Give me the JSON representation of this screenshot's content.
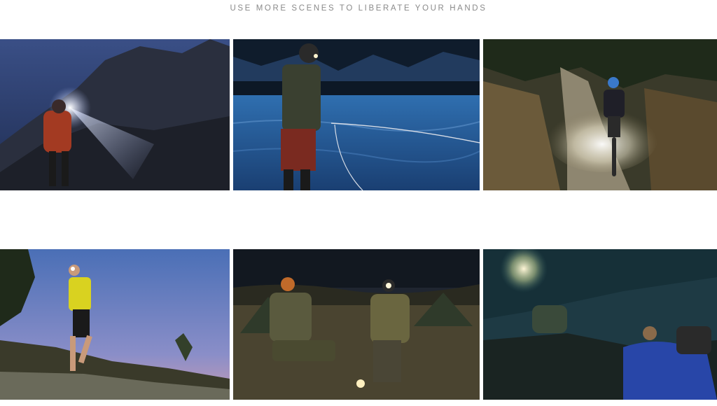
{
  "headline": "USE MORE SCENES TO LIBERATE YOUR HANDS",
  "colors": {
    "background": "#ffffff",
    "headline": "#8a8a8a",
    "night_sky": "#2b4a7a",
    "headlamp_glow": "#fff6d8"
  },
  "scenes": [
    {
      "subject": "hiker-on-mountain-ridge"
    },
    {
      "subject": "fly-fishing-in-river"
    },
    {
      "subject": "mountain-biking-on-trail"
    },
    {
      "subject": "trail-running-at-dusk"
    },
    {
      "subject": "camping-by-tents"
    },
    {
      "subject": "caving-and-sleeping-bag"
    }
  ]
}
